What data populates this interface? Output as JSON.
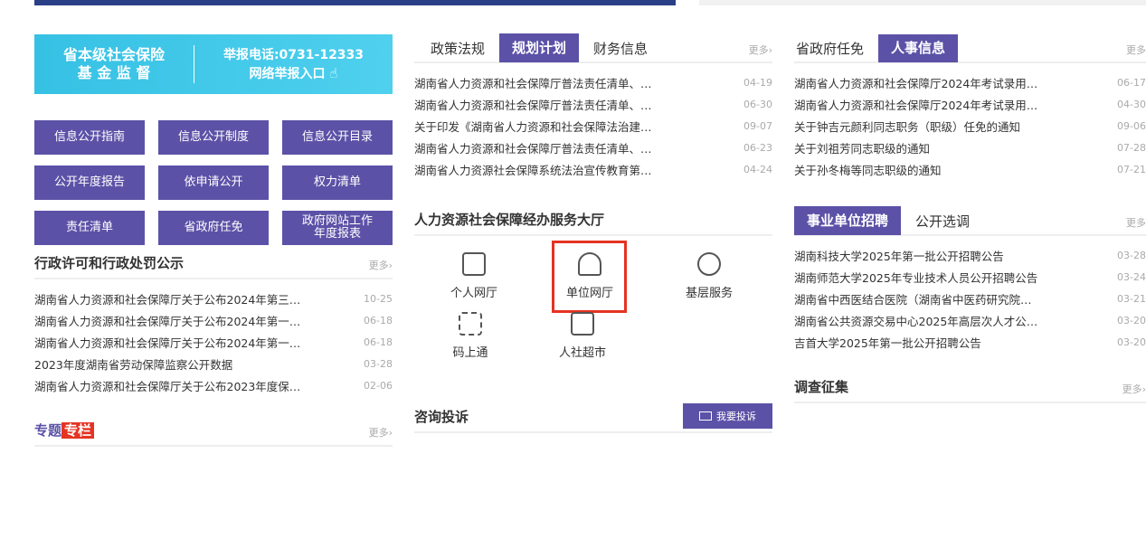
{
  "col1": {
    "banner": {
      "left_line1": "省本级社会保险",
      "left_line2": "基 金 监 督",
      "right_line1": "举报电话:0731-12333",
      "right_line2": "网络举报入口"
    },
    "grid": [
      "信息公开指南",
      "信息公开制度",
      "信息公开目录",
      "公开年度报告",
      "依申请公开",
      "权力清单",
      "责任清单",
      "省政府任免"
    ],
    "grid_last_line1": "政府网站工作",
    "grid_last_line2": "年度报表",
    "section_title": "行政许可和行政处罚公示",
    "more": "更多›",
    "list": [
      {
        "title": "湖南省人力资源和社会保障厅关于公布2024年第三…",
        "date": "10-25"
      },
      {
        "title": "湖南省人力资源和社会保障厅关于公布2024年第一…",
        "date": "06-18"
      },
      {
        "title": "湖南省人力资源和社会保障厅关于公布2024年第一…",
        "date": "06-18"
      },
      {
        "title": "2023年度湖南省劳动保障监察公开数据",
        "date": "03-28"
      },
      {
        "title": "湖南省人力资源和社会保障厅关于公布2023年度保…",
        "date": "02-06"
      }
    ],
    "special_title_a": "专题",
    "special_title_b": "专栏",
    "special_more": "更多›"
  },
  "col2": {
    "tabs": [
      "政策法规",
      "规划计划",
      "财务信息"
    ],
    "more": "更多›",
    "list": [
      {
        "title": "湖南省人力资源和社会保障厅普法责任清单、…",
        "date": "04-19"
      },
      {
        "title": "湖南省人力资源和社会保障厅普法责任清单、…",
        "date": "06-30"
      },
      {
        "title": "关于印发《湖南省人力资源和社会保障法治建…",
        "date": "09-07"
      },
      {
        "title": "湖南省人力资源和社会保障厅普法责任清单、…",
        "date": "06-23"
      },
      {
        "title": "湖南省人力资源社会保障系统法治宣传教育第…",
        "date": "04-24"
      }
    ],
    "service_title": "人力资源社会保障经办服务大厅",
    "services": [
      "个人网厅",
      "单位网厅",
      "基层服务",
      "码上通",
      "人社超市"
    ],
    "consult_title": "咨询投诉",
    "complaint_btn": "我要投诉"
  },
  "col3": {
    "tabs": [
      "省政府任免",
      "人事信息"
    ],
    "more": "更多",
    "list": [
      {
        "title": "湖南省人力资源和社会保障厅2024年考试录用…",
        "date": "06-17"
      },
      {
        "title": "湖南省人力资源和社会保障厅2024年考试录用…",
        "date": "04-30"
      },
      {
        "title": "关于钟吉元颜利同志职务（职级）任免的通知",
        "date": "09-06"
      },
      {
        "title": "关于刘祖芳同志职级的通知",
        "date": "07-28"
      },
      {
        "title": "关于孙冬梅等同志职级的通知",
        "date": "07-21"
      }
    ],
    "tabs2": [
      "事业单位招聘",
      "公开选调"
    ],
    "more2": "更多",
    "list2": [
      {
        "title": "湖南科技大学2025年第一批公开招聘公告",
        "date": "03-28"
      },
      {
        "title": "湖南师范大学2025年专业技术人员公开招聘公告",
        "date": "03-24"
      },
      {
        "title": "湖南省中西医结合医院（湖南省中医药研究院…",
        "date": "03-21"
      },
      {
        "title": "湖南省公共资源交易中心2025年高层次人才公…",
        "date": "03-20"
      },
      {
        "title": "吉首大学2025年第一批公开招聘公告",
        "date": "03-20"
      }
    ],
    "survey_title": "调查征集",
    "survey_more": "更多›"
  }
}
